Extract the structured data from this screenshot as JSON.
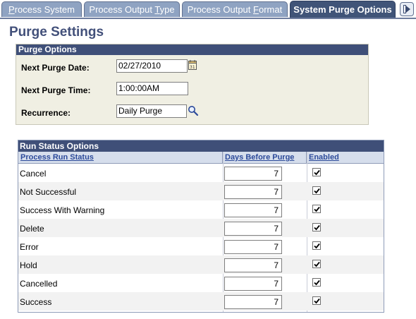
{
  "tabs": [
    {
      "label_pre": "",
      "label_u": "P",
      "label_post": "rocess System"
    },
    {
      "label_pre": "Process Output ",
      "label_u": "T",
      "label_post": "ype"
    },
    {
      "label_pre": "Process Output ",
      "label_u": "F",
      "label_post": "ormat"
    },
    {
      "label_pre": "System Purge Options",
      "label_u": "",
      "label_post": ""
    }
  ],
  "page_title": "Purge Settings",
  "purge_options": {
    "header": "Purge Options",
    "next_purge_date_label": "Next Purge Date:",
    "next_purge_date_value": "02/27/2010",
    "next_purge_time_label": "Next Purge Time:",
    "next_purge_time_value": "1:00:00AM",
    "recurrence_label": "Recurrence:",
    "recurrence_value": "Daily Purge"
  },
  "run_status": {
    "title": "Run Status Options",
    "headers": {
      "status": "Process Run Status",
      "days": "Days Before Purge",
      "enabled": "Enabled"
    },
    "rows": [
      {
        "status": "Cancel",
        "days": "7",
        "enabled": true
      },
      {
        "status": "Not Successful",
        "days": "7",
        "enabled": true
      },
      {
        "status": "Success With Warning",
        "days": "7",
        "enabled": true
      },
      {
        "status": "Delete",
        "days": "7",
        "enabled": true
      },
      {
        "status": "Error",
        "days": "7",
        "enabled": true
      },
      {
        "status": "Hold",
        "days": "7",
        "enabled": true
      },
      {
        "status": "Cancelled",
        "days": "7",
        "enabled": true
      },
      {
        "status": "Success",
        "days": "7",
        "enabled": true
      }
    ]
  },
  "colors": {
    "accent": "#3f4f78",
    "tab_inactive": "#8fa3c2",
    "title": "#42507a"
  },
  "icons": {
    "calendar": "calendar-icon",
    "lookup": "magnifier-lookup-icon",
    "next_tab": "next-tab-arrow-icon",
    "checkbox": "checkmark-icon"
  }
}
